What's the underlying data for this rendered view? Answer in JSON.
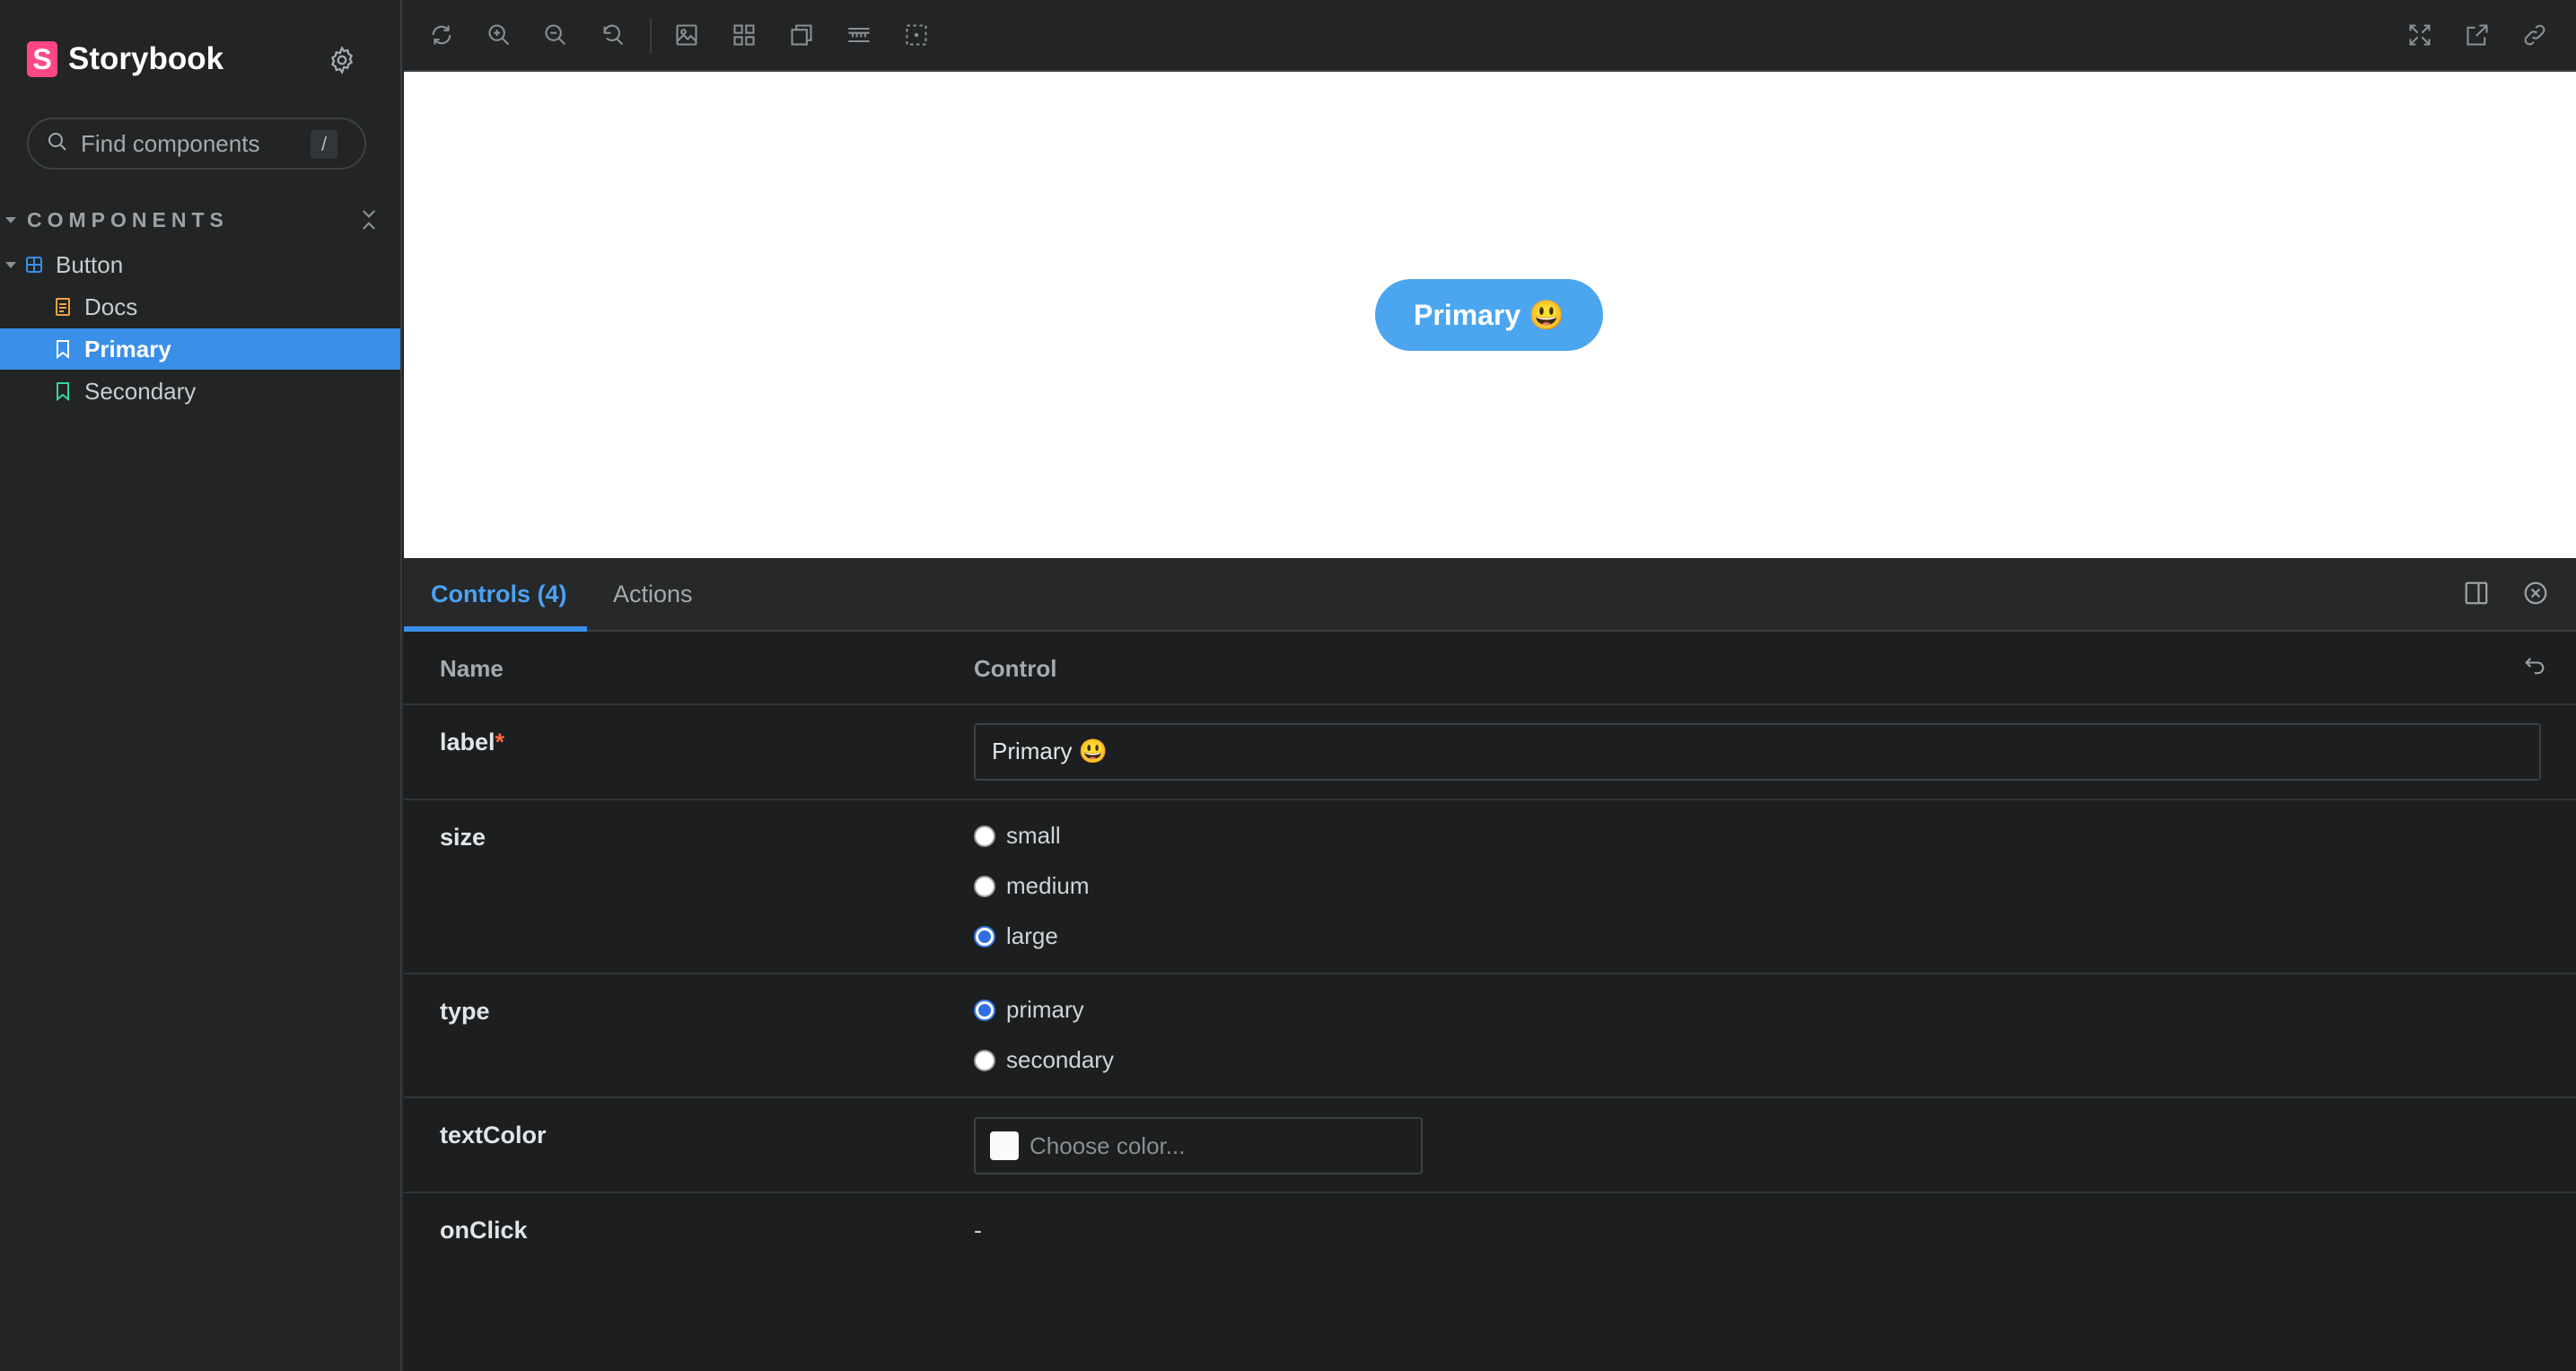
{
  "app": {
    "name": "Storybook"
  },
  "search": {
    "placeholder": "Find components",
    "shortcut": "/"
  },
  "sidebar": {
    "section_label": "COMPONENTS",
    "items": [
      {
        "label": "Button",
        "icon": "component-icon"
      },
      {
        "label": "Docs",
        "icon": "document-icon"
      },
      {
        "label": "Primary",
        "icon": "bookmark-icon",
        "selected": true
      },
      {
        "label": "Secondary",
        "icon": "bookmark-icon"
      }
    ]
  },
  "toolbar": {
    "icons": [
      "reload-icon",
      "zoom-in-icon",
      "zoom-out-icon",
      "zoom-reset-icon",
      "image-icon",
      "grid-icon",
      "outline-icon",
      "ruler-icon",
      "measure-icon",
      "fullscreen-icon",
      "open-new-tab-icon",
      "copy-link-icon"
    ]
  },
  "preview": {
    "button_label": "Primary 😃"
  },
  "panel": {
    "tabs": [
      {
        "label": "Controls (4)",
        "active": true
      },
      {
        "label": "Actions"
      }
    ],
    "columns": {
      "name": "Name",
      "control": "Control"
    },
    "rows": {
      "label": {
        "name": "label",
        "required_mark": "*",
        "value": "Primary 😃"
      },
      "size": {
        "name": "size",
        "options": [
          "small",
          "medium",
          "large"
        ],
        "selected": "large"
      },
      "type": {
        "name": "type",
        "options": [
          "primary",
          "secondary"
        ],
        "selected": "primary"
      },
      "textColor": {
        "name": "textColor",
        "placeholder": "Choose color..."
      },
      "onClick": {
        "name": "onClick",
        "value": "-"
      }
    }
  },
  "colors": {
    "accent": "#3a8fe8",
    "brand": "#ff4785",
    "button": "#4ba6ef"
  }
}
